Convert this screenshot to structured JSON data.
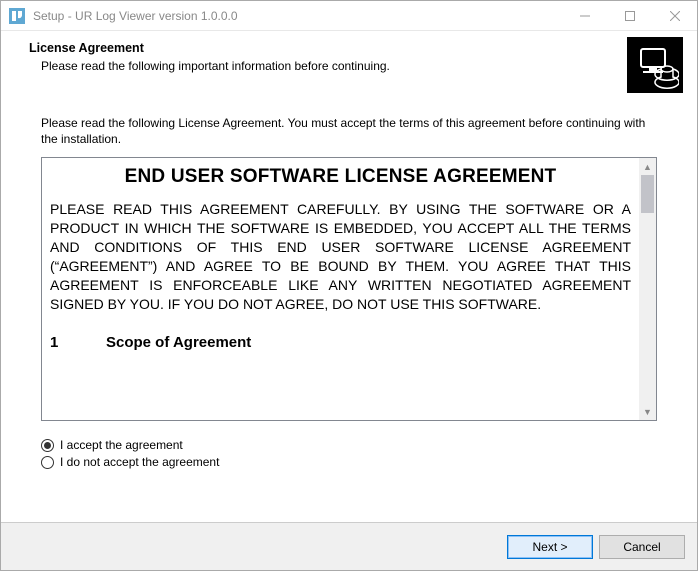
{
  "window": {
    "title": "Setup - UR Log Viewer version 1.0.0.0"
  },
  "header": {
    "heading": "License Agreement",
    "subheading": "Please read the following important information before continuing."
  },
  "content": {
    "instruction": "Please read the following License Agreement. You must accept the terms of this agreement before continuing with the installation.",
    "eula": {
      "title": "END USER SOFTWARE LICENSE AGREEMENT",
      "body": "PLEASE READ THIS AGREEMENT CAREFULLY. BY USING THE SOFTWARE OR A PRODUCT IN WHICH THE SOFTWARE IS EMBEDDED, YOU ACCEPT ALL THE TERMS AND CONDITIONS OF THIS END USER SOFTWARE LICENSE AGREEMENT (“AGREEMENT”) AND AGREE TO BE BOUND BY THEM. YOU AGREE THAT THIS AGREEMENT IS ENFORCEABLE LIKE ANY WRITTEN NEGOTIATED AGREEMENT SIGNED BY YOU. IF YOU DO NOT AGREE, DO NOT USE THIS SOFTWARE.",
      "section_num": "1",
      "section_title": "Scope of Agreement"
    },
    "radios": {
      "accept": "I accept the agreement",
      "decline": "I do not accept the agreement",
      "selected": "accept"
    }
  },
  "footer": {
    "next": "Next >",
    "cancel": "Cancel"
  }
}
